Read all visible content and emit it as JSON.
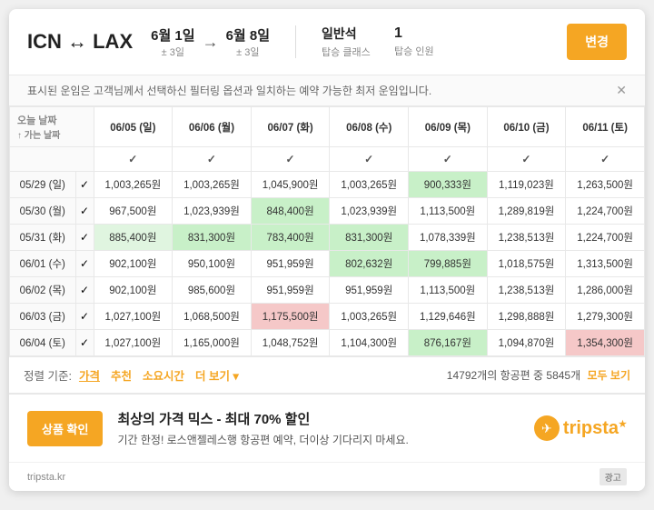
{
  "header": {
    "route": "ICN ↔ LAX",
    "depart_date": "6월 1일",
    "depart_pm": "± 3일",
    "arrow": "→",
    "return_date": "6월 8일",
    "return_pm": "± 3일",
    "cabin_class": "일반석",
    "cabin_label": "탑승 클래스",
    "pax": "1",
    "pax_label": "탑승 인원",
    "change_btn": "변경"
  },
  "notice": "표시된 운임은 고객님께서 선택하신 필터링 옵션과 일치하는 예약 가능한 최저 운임입니다.",
  "calendar": {
    "today_label": "오늘 날짜",
    "going_label": "↑ 가는 날짜",
    "columns": [
      {
        "date": "06/05 (일)",
        "check": "✓"
      },
      {
        "date": "06/06 (월)",
        "check": "✓"
      },
      {
        "date": "06/07 (화)",
        "check": "✓"
      },
      {
        "date": "06/08 (수)",
        "check": "✓"
      },
      {
        "date": "06/09 (목)",
        "check": "✓"
      },
      {
        "date": "06/10 (금)",
        "check": "✓"
      },
      {
        "date": "06/11 (토)",
        "check": "✓"
      }
    ],
    "rows": [
      {
        "date": "05/29 (일)",
        "check": "✓",
        "prices": [
          "1,003,265원",
          "1,003,265원",
          "1,045,900원",
          "1,003,265원",
          "900,333원",
          "1,119,023원",
          "1,263,500원"
        ],
        "highlights": [
          "",
          "",
          "",
          "",
          "green",
          "",
          ""
        ]
      },
      {
        "date": "05/30 (월)",
        "check": "✓",
        "prices": [
          "967,500원",
          "1,023,939원",
          "848,400원",
          "1,023,939원",
          "1,113,500원",
          "1,289,819원",
          "1,224,700원"
        ],
        "highlights": [
          "",
          "",
          "green",
          "",
          "",
          "",
          ""
        ]
      },
      {
        "date": "05/31 (화)",
        "check": "✓",
        "prices": [
          "885,400원",
          "831,300원",
          "783,400원",
          "831,300원",
          "1,078,339원",
          "1,238,513원",
          "1,224,700원"
        ],
        "highlights": [
          "light-green",
          "green",
          "green",
          "green",
          "",
          "",
          ""
        ]
      },
      {
        "date": "06/01 (수)",
        "check": "✓",
        "prices": [
          "902,100원",
          "950,100원",
          "951,959원",
          "802,632원",
          "799,885원",
          "1,018,575원",
          "1,313,500원"
        ],
        "highlights": [
          "",
          "",
          "",
          "green",
          "green",
          "",
          ""
        ]
      },
      {
        "date": "06/02 (목)",
        "check": "✓",
        "prices": [
          "902,100원",
          "985,600원",
          "951,959원",
          "951,959원",
          "1,113,500원",
          "1,238,513원",
          "1,286,000원"
        ],
        "highlights": [
          "",
          "",
          "",
          "",
          "",
          "",
          ""
        ]
      },
      {
        "date": "06/03 (금)",
        "check": "✓",
        "prices": [
          "1,027,100원",
          "1,068,500원",
          "1,175,500원",
          "1,003,265원",
          "1,129,646원",
          "1,298,888원",
          "1,279,300원"
        ],
        "highlights": [
          "",
          "",
          "pink",
          "",
          "",
          "",
          ""
        ]
      },
      {
        "date": "06/04 (토)",
        "check": "✓",
        "prices": [
          "1,027,100원",
          "1,165,000원",
          "1,048,752원",
          "1,104,300원",
          "876,167원",
          "1,094,870원",
          "1,354,300원"
        ],
        "highlights": [
          "",
          "",
          "",
          "",
          "green",
          "",
          "pink"
        ]
      }
    ]
  },
  "sort_bar": {
    "label": "정렬 기준:",
    "options": [
      "가격",
      "추천",
      "소요시간",
      "더 보기 ▾"
    ],
    "result_text": "14792개의 항공편 중 5845개",
    "view_all": "모두 보기"
  },
  "ad": {
    "btn_label": "상품 확인",
    "title": "최상의 가격 믹스 - 최대 70% 할인",
    "desc": "기간 한정! 로스앤젤레스행 항공편 예약, 더이상 기다리지 마세요.",
    "logo": "tripsta",
    "logo_symbol": "✈",
    "url": "tripsta.kr",
    "ad_tag": "광고"
  }
}
